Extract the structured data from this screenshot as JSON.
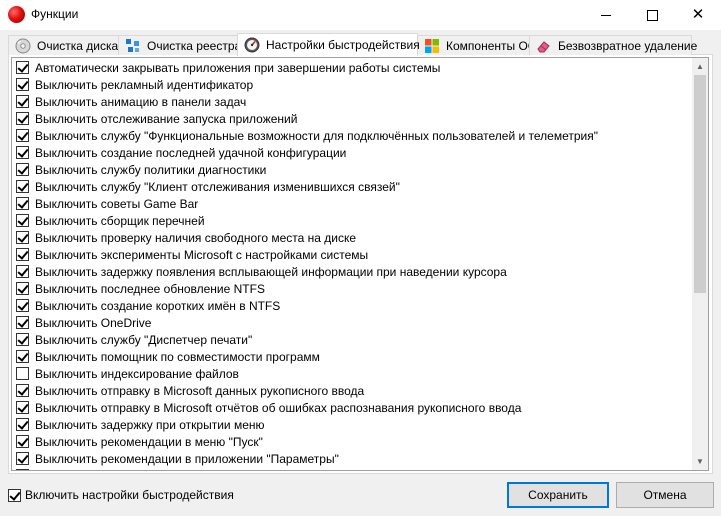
{
  "window": {
    "title": "Функции"
  },
  "tabs": [
    {
      "label": "Очистка диска",
      "icon": "disk-cleanup-icon",
      "active": false
    },
    {
      "label": "Очистка реестра",
      "icon": "registry-cleanup-icon",
      "active": false
    },
    {
      "label": "Настройки быстродействия",
      "icon": "speedometer-icon",
      "active": true
    },
    {
      "label": "Компоненты ОС",
      "icon": "windows-logo-icon",
      "active": false
    },
    {
      "label": "Безвозвратное удаление",
      "icon": "eraser-icon",
      "active": false
    }
  ],
  "items": [
    {
      "label": "Автоматически закрывать приложения при завершении работы системы",
      "checked": true
    },
    {
      "label": "Выключить рекламный идентификатор",
      "checked": true
    },
    {
      "label": "Выключить анимацию в панели задач",
      "checked": true
    },
    {
      "label": "Выключить отслеживание запуска приложений",
      "checked": true
    },
    {
      "label": "Выключить службу \"Функциональные возможности для подключённых пользователей и телеметрия\"",
      "checked": true
    },
    {
      "label": "Выключить создание последней удачной конфигурации",
      "checked": true
    },
    {
      "label": "Выключить службу политики диагностики",
      "checked": true
    },
    {
      "label": "Выключить службу \"Клиент отслеживания изменившихся связей\"",
      "checked": true
    },
    {
      "label": "Выключить советы Game Bar",
      "checked": true
    },
    {
      "label": "Выключить сборщик перечней",
      "checked": true
    },
    {
      "label": "Выключить проверку наличия свободного места на диске",
      "checked": true
    },
    {
      "label": "Выключить эксперименты Microsoft с настройками системы",
      "checked": true
    },
    {
      "label": "Выключить задержку появления всплывающей информации при наведении курсора",
      "checked": true
    },
    {
      "label": "Выключить последнее обновление NTFS",
      "checked": true
    },
    {
      "label": "Выключить создание коротких имён в NTFS",
      "checked": true
    },
    {
      "label": "Выключить OneDrive",
      "checked": true
    },
    {
      "label": "Выключить службу \"Диспетчер печати\"",
      "checked": true
    },
    {
      "label": "Выключить помощник по совместимости программ",
      "checked": true
    },
    {
      "label": "Выключить индексирование файлов",
      "checked": false
    },
    {
      "label": "Выключить отправку в Microsoft данных рукописного ввода",
      "checked": true
    },
    {
      "label": "Выключить отправку в Microsoft отчётов об ошибках распознавания рукописного ввода",
      "checked": true
    },
    {
      "label": "Выключить задержку при открытии меню",
      "checked": true
    },
    {
      "label": "Выключить рекомендации в меню \"Пуск\"",
      "checked": true
    },
    {
      "label": "Выключить рекомендации в приложении \"Параметры\"",
      "checked": true
    },
    {
      "label": "",
      "checked": true
    }
  ],
  "footer": {
    "enable_label": "Включить настройки быстродействия",
    "enable_checked": true,
    "save_label": "Сохранить",
    "cancel_label": "Отмена"
  },
  "colors": {
    "accent": "#0078d7",
    "app_icon": "#e01010"
  }
}
